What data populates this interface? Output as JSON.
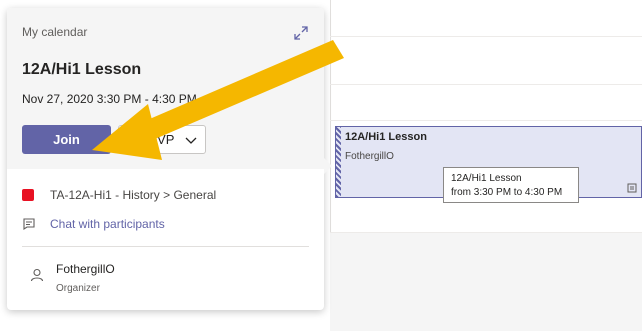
{
  "card": {
    "label": "My calendar",
    "title": "12A/Hi1 Lesson",
    "time": "Nov 27, 2020 3:30 PM - 4:30 PM",
    "join_label": "Join",
    "rsvp_label": "RSVP",
    "channel": "TA-12A-Hi1 - History > General",
    "chat_label": "Chat with participants",
    "organizer_name": "FothergillO",
    "organizer_role": "Organizer"
  },
  "event": {
    "title": "12A/Hi1 Lesson",
    "organizer": "FothergillO"
  },
  "tooltip": {
    "line1": "12A/Hi1 Lesson",
    "line2": "from 3:30 PM to 4:30 PM"
  },
  "colors": {
    "accent": "#6264a7",
    "team_badge": "#e81123",
    "annotation_arrow": "#f5b700"
  },
  "icons": {
    "expand": "expand-icon",
    "chevron": "chevron-down-icon",
    "team": "team-channel-icon",
    "chat": "chat-icon",
    "organizer": "person-icon",
    "event": "event-options-icon"
  }
}
